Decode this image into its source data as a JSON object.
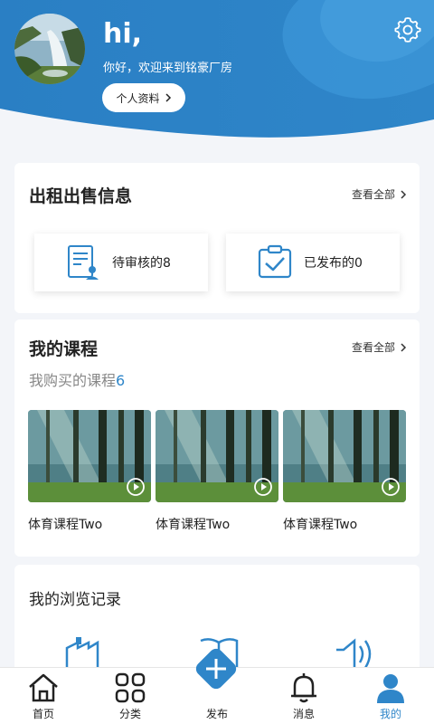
{
  "header": {
    "greeting": "hi,",
    "welcome": "你好，欢迎来到铭豪厂房",
    "profile_button": "个人资料",
    "colors": {
      "primary": "#2f86c9",
      "light": "#3d97d8"
    }
  },
  "rental_sale": {
    "title": "出租出售信息",
    "view_all": "查看全部",
    "stats": [
      {
        "label": "待审核的8",
        "icon": "document-review-icon"
      },
      {
        "label": "已发布的0",
        "icon": "clipboard-check-icon"
      }
    ]
  },
  "courses": {
    "title": "我的课程",
    "view_all": "查看全部",
    "purchased_label": "我购买的课程",
    "purchased_count": "6",
    "items": [
      {
        "name": "体育课程Two"
      },
      {
        "name": "体育课程Two"
      },
      {
        "name": "体育课程Two"
      }
    ]
  },
  "history": {
    "title": "我的浏览记录"
  },
  "tabbar": {
    "items": [
      {
        "label": "首页",
        "icon": "home-icon"
      },
      {
        "label": "分类",
        "icon": "grid-icon"
      },
      {
        "label": "发布",
        "icon": "plus-icon"
      },
      {
        "label": "消息",
        "icon": "bell-icon"
      },
      {
        "label": "我的",
        "icon": "user-icon"
      }
    ],
    "active": "我的"
  }
}
